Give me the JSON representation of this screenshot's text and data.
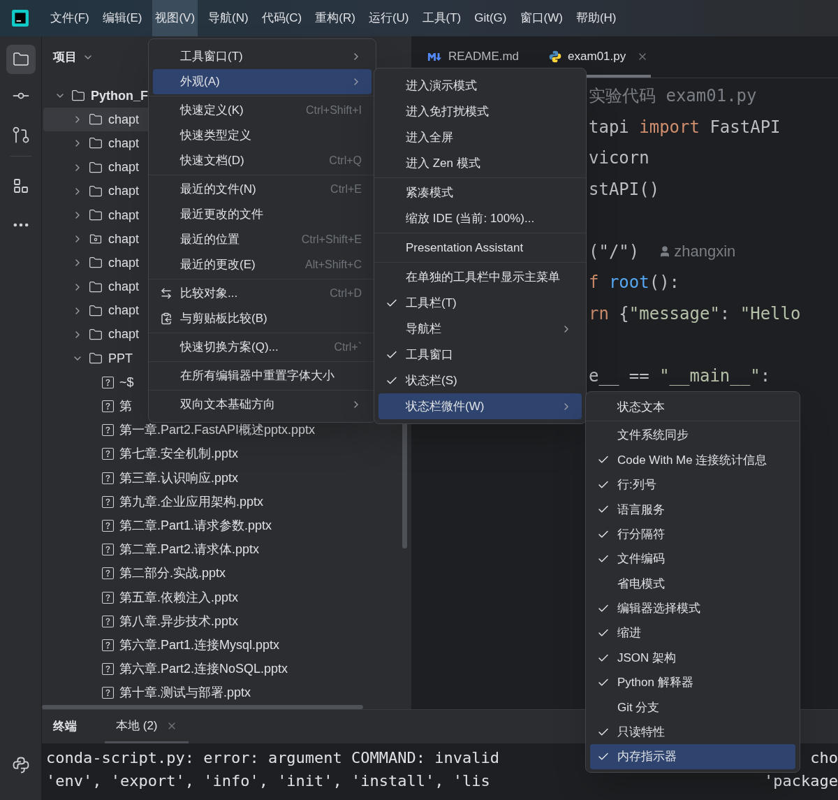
{
  "menu_bar": [
    {
      "label": "文件(F)",
      "selected": false
    },
    {
      "label": "编辑(E)",
      "selected": false
    },
    {
      "label": "视图(V)",
      "selected": true
    },
    {
      "label": "导航(N)",
      "selected": false
    },
    {
      "label": "代码(C)",
      "selected": false
    },
    {
      "label": "重构(R)",
      "selected": false
    },
    {
      "label": "运行(U)",
      "selected": false
    },
    {
      "label": "工具(T)",
      "selected": false
    },
    {
      "label": "Git(G)",
      "selected": false
    },
    {
      "label": "窗口(W)",
      "selected": false
    },
    {
      "label": "帮助(H)",
      "selected": false
    }
  ],
  "project_panel": {
    "title": "项目",
    "tree": [
      {
        "label": "Python_F",
        "kind": "folder",
        "expanded": true,
        "selected": false,
        "children": [
          {
            "label": "chapt",
            "kind": "folder",
            "expanded": false,
            "selected": true
          },
          {
            "label": "chapt",
            "kind": "folder",
            "expanded": false,
            "selected": false
          },
          {
            "label": "chapt",
            "kind": "folder",
            "expanded": false,
            "selected": false
          },
          {
            "label": "chapt",
            "kind": "folder",
            "expanded": false,
            "selected": false
          },
          {
            "label": "chapt",
            "kind": "folder",
            "expanded": false,
            "selected": false
          },
          {
            "label": "chapt",
            "kind": "package",
            "expanded": false,
            "selected": false
          },
          {
            "label": "chapt",
            "kind": "folder",
            "expanded": false,
            "selected": false
          },
          {
            "label": "chapt",
            "kind": "folder",
            "expanded": false,
            "selected": false
          },
          {
            "label": "chapt",
            "kind": "folder",
            "expanded": false,
            "selected": false
          },
          {
            "label": "chapt",
            "kind": "folder",
            "expanded": false,
            "selected": false
          },
          {
            "label": "PPT",
            "kind": "folder",
            "expanded": true,
            "selected": false,
            "children": [
              {
                "label": "~$",
                "kind": "file",
                "selected": false
              },
              {
                "label": "第",
                "kind": "file",
                "selected": false
              },
              {
                "label": "第一章.Part2.FastAPI概述pptx.pptx",
                "kind": "file",
                "selected": false
              },
              {
                "label": "第七章.安全机制.pptx",
                "kind": "file",
                "selected": false
              },
              {
                "label": "第三章.认识响应.pptx",
                "kind": "file",
                "selected": false
              },
              {
                "label": "第九章.企业应用架构.pptx",
                "kind": "file",
                "selected": false
              },
              {
                "label": "第二章.Part1.请求参数.pptx",
                "kind": "file",
                "selected": false
              },
              {
                "label": "第二章.Part2.请求体.pptx",
                "kind": "file",
                "selected": false
              },
              {
                "label": "第二部分.实战.pptx",
                "kind": "file",
                "selected": false
              },
              {
                "label": "第五章.依赖注入.pptx",
                "kind": "file",
                "selected": false
              },
              {
                "label": "第八章.异步技术.pptx",
                "kind": "file",
                "selected": false
              },
              {
                "label": "第六章.Part1.连接Mysql.pptx",
                "kind": "file",
                "selected": false
              },
              {
                "label": "第六章.Part2.连接NoSQL.pptx",
                "kind": "file",
                "selected": false
              },
              {
                "label": "第十章.测试与部署.pptx",
                "kind": "file",
                "selected": false
              }
            ]
          }
        ]
      }
    ]
  },
  "editor": {
    "tabs": [
      {
        "label": "README.md",
        "kind": "markdown",
        "selected": false,
        "closable": false
      },
      {
        "label": "exam01.py",
        "kind": "python",
        "selected": true,
        "closable": true
      }
    ],
    "code_lines": [
      {
        "kind": "code",
        "segments": [
          {
            "kind": "comment",
            "text": "实验代码 exam01.py"
          }
        ]
      },
      {
        "kind": "code",
        "segments": [
          {
            "kind": "plain",
            "text": "tapi "
          },
          {
            "kind": "keyword",
            "text": "import"
          },
          {
            "kind": "plain",
            "text": " FastAPI"
          }
        ]
      },
      {
        "kind": "code",
        "segments": [
          {
            "kind": "plain",
            "text": "vicorn"
          }
        ]
      },
      {
        "kind": "code",
        "segments": [
          {
            "kind": "plain",
            "text": "stAPI()"
          }
        ]
      },
      {
        "kind": "blank"
      },
      {
        "kind": "code",
        "segments": [
          {
            "kind": "plain",
            "text": "(\"/\")"
          },
          {
            "kind": "author",
            "text": "zhangxin"
          }
        ]
      },
      {
        "kind": "code",
        "segments": [
          {
            "kind": "keyword",
            "text": "f"
          },
          {
            "kind": "function",
            "text": " root"
          },
          {
            "kind": "plain",
            "text": "():"
          }
        ]
      },
      {
        "kind": "code",
        "segments": [
          {
            "kind": "keyword",
            "text": "rn"
          },
          {
            "kind": "plain",
            "text": " {"
          },
          {
            "kind": "string",
            "text": "\"message\""
          },
          {
            "kind": "plain",
            "text": ": "
          },
          {
            "kind": "string",
            "text": "\"Hello"
          }
        ]
      },
      {
        "kind": "blank"
      },
      {
        "kind": "code",
        "segments": [
          {
            "kind": "plain",
            "text": "e__ == "
          },
          {
            "kind": "string",
            "text": "\"__main__\""
          },
          {
            "kind": "plain",
            "text": ":"
          }
        ]
      }
    ]
  },
  "terminal": {
    "title": "终端",
    "tabs": [
      {
        "label": "本地 (2)",
        "selected": true,
        "closable": true
      }
    ],
    "lines": [
      {
        "left": "conda-script.py: error: argument COMMAND: invalid",
        "right": "cho"
      },
      {
        "left": "'env', 'export', 'info', 'init', 'install', 'lis",
        "right": "'package"
      }
    ]
  },
  "menus": [
    {
      "items": [
        {
          "kind": "item",
          "label": "工具窗口(T)",
          "submenu": true,
          "selected": false,
          "icon": false
        },
        {
          "kind": "item",
          "label": "外观(A)",
          "submenu": true,
          "selected": true,
          "icon": false
        },
        {
          "kind": "separator"
        },
        {
          "kind": "item",
          "label": "快速定义(K)",
          "shortcut": "Ctrl+Shift+I",
          "submenu": false,
          "selected": false,
          "icon": false
        },
        {
          "kind": "item",
          "label": "快速类型定义",
          "submenu": false,
          "selected": false,
          "icon": false
        },
        {
          "kind": "item",
          "label": "快速文档(D)",
          "shortcut": "Ctrl+Q",
          "submenu": false,
          "selected": false,
          "icon": false
        },
        {
          "kind": "separator"
        },
        {
          "kind": "item",
          "label": "最近的文件(N)",
          "shortcut": "Ctrl+E",
          "submenu": false,
          "selected": false,
          "icon": false
        },
        {
          "kind": "item",
          "label": "最近更改的文件",
          "submenu": false,
          "selected": false,
          "icon": false
        },
        {
          "kind": "item",
          "label": "最近的位置",
          "shortcut": "Ctrl+Shift+E",
          "submenu": false,
          "selected": false,
          "icon": false
        },
        {
          "kind": "item",
          "label": "最近的更改(E)",
          "shortcut": "Alt+Shift+C",
          "submenu": false,
          "selected": false,
          "icon": false
        },
        {
          "kind": "separator"
        },
        {
          "kind": "item",
          "label": "比较对象...",
          "shortcut": "Ctrl+D",
          "submenu": false,
          "selected": false,
          "icon": true
        },
        {
          "kind": "item",
          "label": "与剪贴板比较(B)",
          "submenu": false,
          "selected": false,
          "icon": true
        },
        {
          "kind": "separator"
        },
        {
          "kind": "item",
          "label": "快速切换方案(Q)...",
          "shortcut": "Ctrl+`",
          "submenu": false,
          "selected": false,
          "icon": false
        },
        {
          "kind": "separator"
        },
        {
          "kind": "item",
          "label": "在所有编辑器中重置字体大小",
          "submenu": false,
          "selected": false,
          "icon": false
        },
        {
          "kind": "separator"
        },
        {
          "kind": "item",
          "label": "双向文本基础方向",
          "submenu": true,
          "selected": false,
          "icon": false
        }
      ]
    },
    {
      "items": [
        {
          "kind": "item",
          "label": "进入演示模式",
          "submenu": false,
          "selected": false,
          "checked": false
        },
        {
          "kind": "item",
          "label": "进入免打扰模式",
          "submenu": false,
          "selected": false,
          "checked": false
        },
        {
          "kind": "item",
          "label": "进入全屏",
          "submenu": false,
          "selected": false,
          "checked": false
        },
        {
          "kind": "item",
          "label": "进入 Zen 模式",
          "submenu": false,
          "selected": false,
          "checked": false
        },
        {
          "kind": "separator"
        },
        {
          "kind": "item",
          "label": "紧凑模式",
          "submenu": false,
          "selected": false,
          "checked": false
        },
        {
          "kind": "item",
          "label": "缩放 IDE (当前: 100%)...",
          "submenu": false,
          "selected": false,
          "checked": false
        },
        {
          "kind": "separator"
        },
        {
          "kind": "item",
          "label": "Presentation Assistant",
          "submenu": false,
          "selected": false,
          "checked": false
        },
        {
          "kind": "separator"
        },
        {
          "kind": "item",
          "label": "在单独的工具栏中显示主菜单",
          "submenu": false,
          "selected": false,
          "checked": false
        },
        {
          "kind": "item",
          "label": "工具栏(T)",
          "submenu": false,
          "selected": false,
          "checked": true
        },
        {
          "kind": "item",
          "label": "导航栏",
          "submenu": true,
          "selected": false,
          "checked": false
        },
        {
          "kind": "item",
          "label": "工具窗口",
          "submenu": false,
          "selected": false,
          "checked": true
        },
        {
          "kind": "item",
          "label": "状态栏(S)",
          "submenu": false,
          "selected": false,
          "checked": true
        },
        {
          "kind": "item",
          "label": "状态栏微件(W)",
          "submenu": true,
          "selected": true,
          "checked": false
        }
      ]
    },
    {
      "items": [
        {
          "kind": "item",
          "label": "状态文本",
          "submenu": false,
          "selected": false,
          "checked": false
        },
        {
          "kind": "separator"
        },
        {
          "kind": "item",
          "label": "文件系统同步",
          "submenu": false,
          "selected": false,
          "checked": false
        },
        {
          "kind": "item",
          "label": "Code With Me 连接统计信息",
          "submenu": false,
          "selected": false,
          "checked": true
        },
        {
          "kind": "item",
          "label": "行:列号",
          "submenu": false,
          "selected": false,
          "checked": true
        },
        {
          "kind": "item",
          "label": "语言服务",
          "submenu": false,
          "selected": false,
          "checked": true
        },
        {
          "kind": "item",
          "label": "行分隔符",
          "submenu": false,
          "selected": false,
          "checked": true
        },
        {
          "kind": "item",
          "label": "文件编码",
          "submenu": false,
          "selected": false,
          "checked": true
        },
        {
          "kind": "item",
          "label": "省电模式",
          "submenu": false,
          "selected": false,
          "checked": false
        },
        {
          "kind": "item",
          "label": "编辑器选择模式",
          "submenu": false,
          "selected": false,
          "checked": true
        },
        {
          "kind": "item",
          "label": "缩进",
          "submenu": false,
          "selected": false,
          "checked": true
        },
        {
          "kind": "item",
          "label": "JSON 架构",
          "submenu": false,
          "selected": false,
          "checked": true
        },
        {
          "kind": "item",
          "label": "Python 解释器",
          "submenu": false,
          "selected": false,
          "checked": true
        },
        {
          "kind": "item",
          "label": "Git 分支",
          "submenu": false,
          "selected": false,
          "checked": false
        },
        {
          "kind": "item",
          "label": "只读特性",
          "submenu": false,
          "selected": false,
          "checked": true
        },
        {
          "kind": "item",
          "label": "内存指示器",
          "submenu": false,
          "selected": true,
          "checked": true
        }
      ]
    }
  ]
}
